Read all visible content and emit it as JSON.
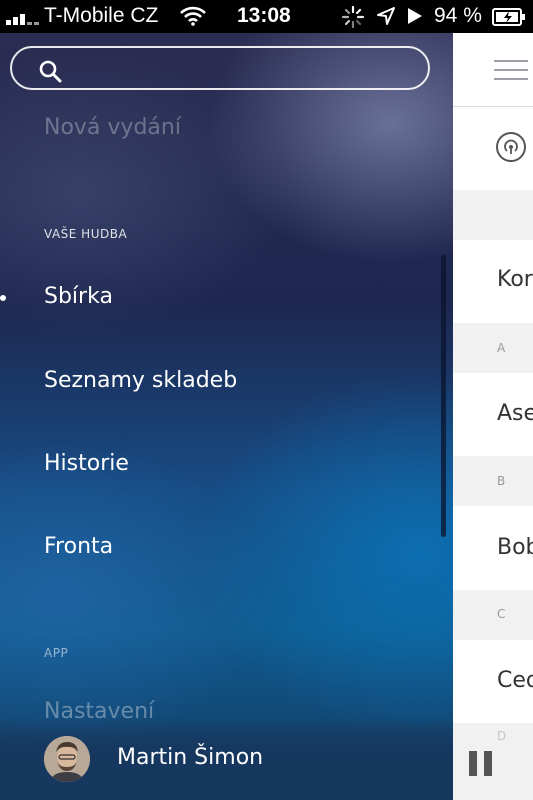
{
  "status_bar": {
    "carrier": "T-Mobile CZ",
    "time": "13:08",
    "battery_percent": "94 %"
  },
  "menu": {
    "search": {
      "placeholder": ""
    },
    "faded_item": "Nová vydání",
    "section_music": "VAŠE HUDBA",
    "items": [
      {
        "label": "Sbírka",
        "active": true
      },
      {
        "label": "Seznamy skladeb"
      },
      {
        "label": "Historie"
      },
      {
        "label": "Fronta"
      }
    ],
    "section_app": "APP",
    "partial_item": "Nastavení"
  },
  "user": {
    "name": "Martin Šimon"
  },
  "content": {
    "rows": [
      "Kor",
      "Ase",
      "Bob",
      "Ced"
    ],
    "letters": [
      "A",
      "B",
      "C",
      "D"
    ]
  },
  "colors": {
    "content_background": "#ffffff",
    "menu_text": "#ffffff"
  },
  "icons": [
    "signal-icon",
    "wifi-icon",
    "activity-spinner-icon",
    "location-icon",
    "play-icon",
    "battery-icon",
    "search-icon",
    "hamburger-icon",
    "radio-icon",
    "pause-icon"
  ]
}
